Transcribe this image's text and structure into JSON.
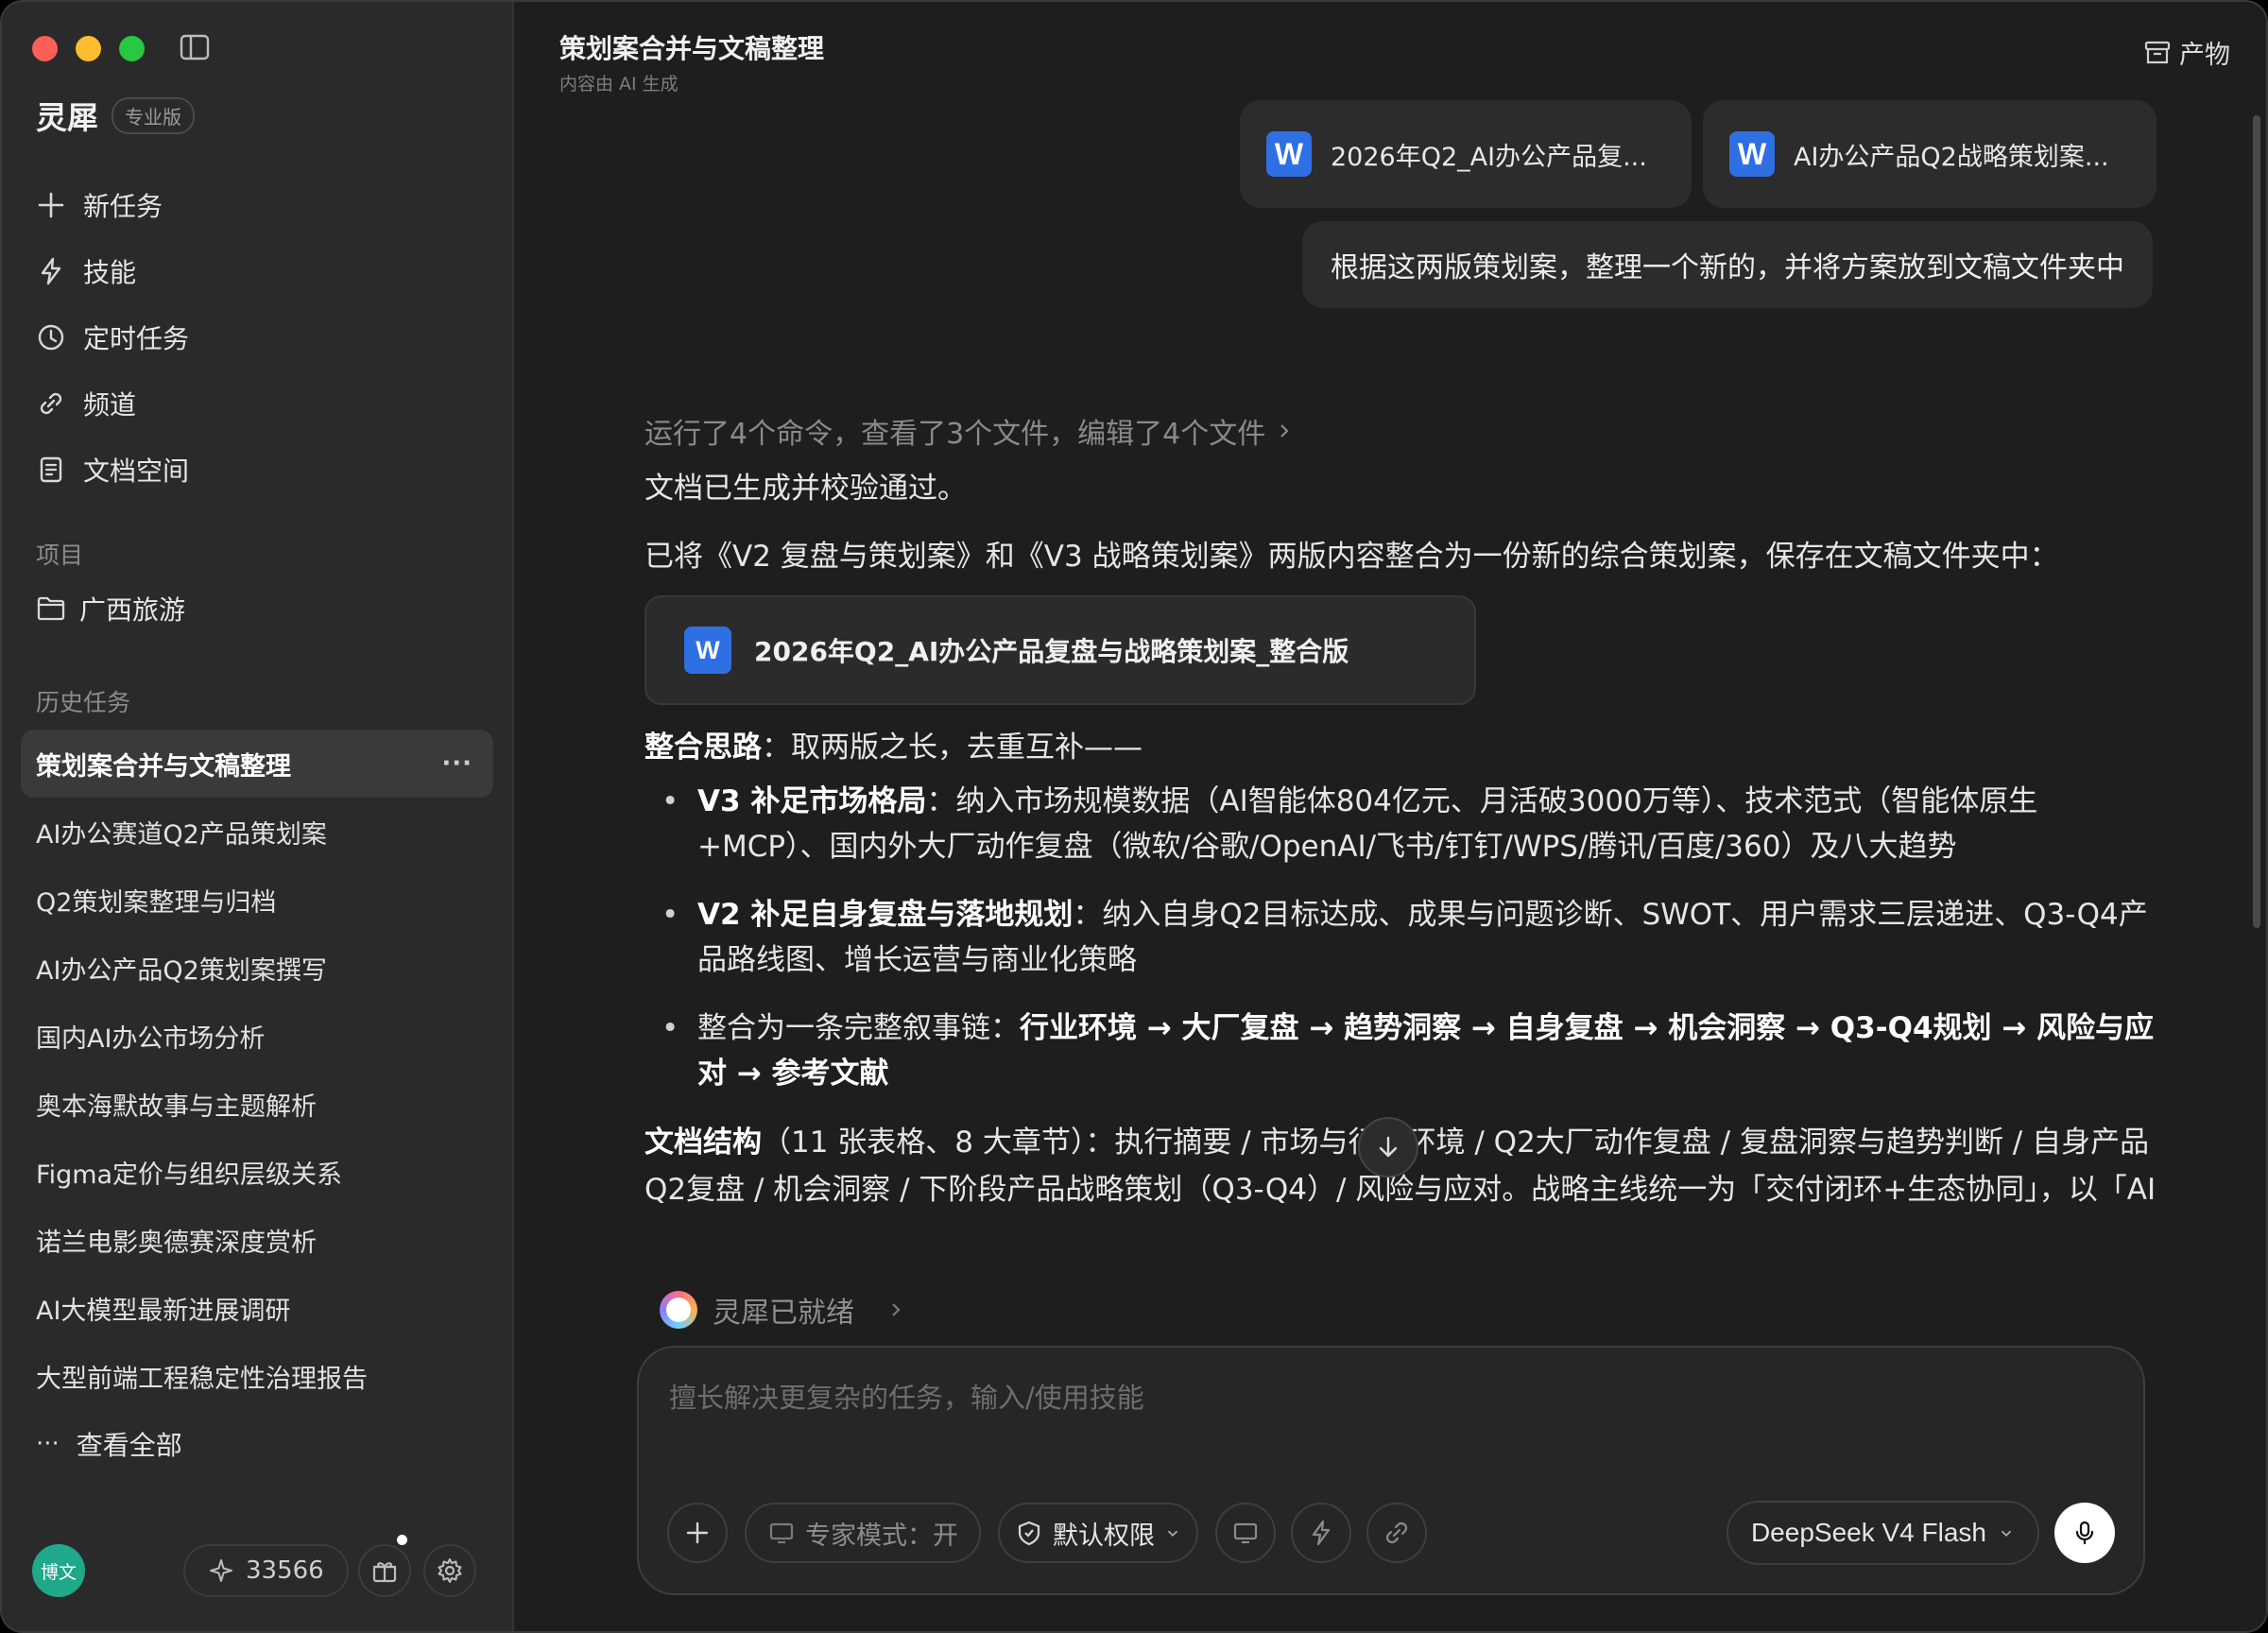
{
  "sidebar": {
    "brand": {
      "name": "灵犀",
      "badge": "专业版"
    },
    "nav": [
      {
        "label": "新任务",
        "icon": "plus-icon"
      },
      {
        "label": "技能",
        "icon": "lightning-icon"
      },
      {
        "label": "定时任务",
        "icon": "clock-icon"
      },
      {
        "label": "频道",
        "icon": "link-icon"
      },
      {
        "label": "文档空间",
        "icon": "document-icon"
      }
    ],
    "projects_title": "项目",
    "project": "广西旅游",
    "history_title": "历史任务",
    "history": [
      "策划案合并与文稿整理",
      "AI办公赛道Q2产品策划案",
      "Q2策划案整理与归档",
      "AI办公产品Q2策划案撰写",
      "国内AI办公市场分析",
      "奥本海默故事与主题解析",
      "Figma定价与组织层级关系",
      "诺兰电影奥德赛深度赏析",
      "AI大模型最新进展调研",
      "大型前端工程稳定性治理报告"
    ],
    "more_label": "···",
    "view_all": "查看全部",
    "user_avatar": "博文",
    "credits": "33566"
  },
  "header": {
    "title": "策划案合并与文稿整理",
    "subtitle": "内容由 AI 生成",
    "artifacts": "产物"
  },
  "conversation": {
    "attachments": [
      "2026年Q2_AI办公产品复...",
      "AI办公产品Q2战略策划案..."
    ],
    "word_letter": "W",
    "user_message": "根据这两版策划案，整理一个新的，并将方案放到文稿文件夹中",
    "activity": "运行了4个命令，查看了3个文件，编辑了4个文件",
    "p1": "文档已生成并校验通过。",
    "p2": "已将《V2 复盘与策划案》和《V3 战略策划案》两版内容整合为一份新的综合策划案，保存在文稿文件夹中：",
    "file_card": "2026年Q2_AI办公产品复盘与战略策划案_整合版",
    "approach_label": "整合思路",
    "approach_text": "：取两版之长，去重互补——",
    "bullets": [
      {
        "bold": "V3 补足市场格局",
        "text": "：纳入市场规模数据（AI智能体804亿元、月活破3000万等）、技术范式（智能体原生+MCP）、国内外大厂动作复盘（微软/谷歌/OpenAI/飞书/钉钉/WPS/腾讯/百度/360）及八大趋势"
      },
      {
        "bold": "V2 补足自身复盘与落地规划",
        "text": "：纳入自身Q2目标达成、成果与问题诊断、SWOT、用户需求三层递进、Q3-Q4产品路线图、增长运营与商业化策略"
      },
      {
        "prefix": "整合为一条完整叙事链：",
        "bold": "行业环境 → 大厂复盘 → 趋势洞察 → 自身复盘 → 机会洞察 → Q3-Q4规划 → 风险与应对 → 参考文献",
        "text": ""
      }
    ],
    "structure_label": "文档结构",
    "structure_text": "（11 张表格、8 大章节）：执行摘要 / 市场与行业环境 / Q2大厂动作复盘 / 复盘洞察与趋势判断 / 自身产品Q2复盘 / 机会洞察 / 下阶段产品战略策划（Q3-Q4）/ 风险与应对。战略主线统一为「交付闭环+生态协同」，以「AI任务完成率」为北极星指标。原文中带「[示例]」口径的目标值均标注为示意数据，便于你按实际经营数据校",
    "status": "灵犀已就绪"
  },
  "composer": {
    "placeholder": "擅长解决更复杂的任务，输入/使用技能",
    "expert_mode": "专家模式：开",
    "permission": "默认权限",
    "model": "DeepSeek V4 Flash"
  }
}
